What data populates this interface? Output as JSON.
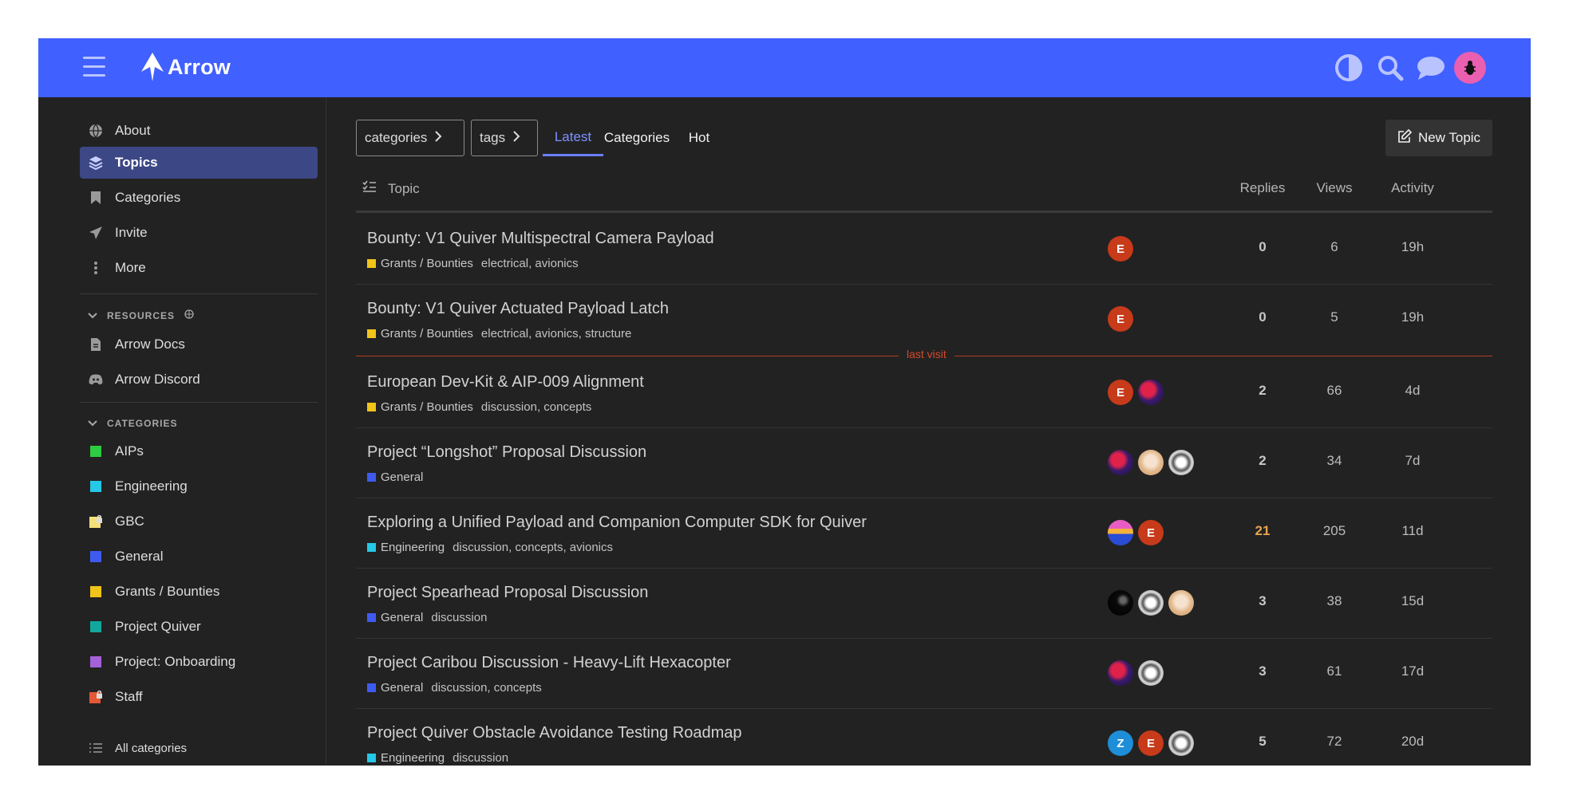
{
  "header": {
    "app_name": "Arrow",
    "accent": "#4060ff",
    "icons": [
      "menu-icon",
      "theme-toggle-icon",
      "search-icon",
      "chat-icon",
      "user-avatar"
    ]
  },
  "sidebar": {
    "main_items": [
      {
        "label": "About",
        "icon": "globe-icon"
      },
      {
        "label": "Topics",
        "icon": "layers-icon",
        "active": true
      },
      {
        "label": "Categories",
        "icon": "bookmark-icon"
      },
      {
        "label": "Invite",
        "icon": "paper-plane-icon"
      },
      {
        "label": "More",
        "icon": "more-vertical-icon"
      }
    ],
    "resources_heading": "RESOURCES",
    "resources": [
      {
        "label": "Arrow Docs",
        "icon": "document-icon"
      },
      {
        "label": "Arrow Discord",
        "icon": "discord-icon"
      }
    ],
    "categories_heading": "CATEGORIES",
    "categories": [
      {
        "label": "AIPs",
        "color": "#2ecc40"
      },
      {
        "label": "Engineering",
        "color": "#25c8e6"
      },
      {
        "label": "GBC",
        "color": "#f4e07a",
        "locked": true
      },
      {
        "label": "General",
        "color": "#3f5bef"
      },
      {
        "label": "Grants / Bounties",
        "color": "#f0c419"
      },
      {
        "label": "Project Quiver",
        "color": "#12a89d"
      },
      {
        "label": "Project: Onboarding",
        "color": "#a461d8"
      },
      {
        "label": "Staff",
        "color": "#e45735",
        "locked": true
      }
    ],
    "all_categories": "All categories"
  },
  "filters": {
    "categories": "categories",
    "tags": "tags",
    "tabs": [
      {
        "label": "Latest",
        "active": true
      },
      {
        "label": "Categories"
      },
      {
        "label": "Hot"
      }
    ],
    "new_topic": "New Topic"
  },
  "table": {
    "col_topic": "Topic",
    "col_replies": "Replies",
    "col_views": "Views",
    "col_activity": "Activity",
    "last_visit": "last visit",
    "rows": [
      {
        "title": "Bounty: V1 Quiver Multispectral Camera Payload",
        "category": "Grants / Bounties",
        "cat_color": "#f0c419",
        "tags": "electrical, avionics",
        "posters": [
          "E"
        ],
        "replies": "0",
        "views": "6",
        "activity": "19h"
      },
      {
        "title": "Bounty: V1 Quiver Actuated Payload Latch",
        "category": "Grants / Bounties",
        "cat_color": "#f0c419",
        "tags": "electrical, avionics, structure",
        "posters": [
          "E"
        ],
        "replies": "0",
        "views": "5",
        "activity": "19h"
      },
      {
        "title": "European Dev-Kit & AIP-009 Alignment",
        "category": "Grants / Bounties",
        "cat_color": "#f0c419",
        "tags": "discussion, concepts",
        "posters": [
          "E",
          "img-spider"
        ],
        "replies": "2",
        "views": "66",
        "activity": "4d"
      },
      {
        "title": "Project “Longshot” Proposal Discussion",
        "category": "General",
        "cat_color": "#3f5bef",
        "tags": "",
        "posters": [
          "img-spider",
          "img-blonde",
          "img-bw"
        ],
        "replies": "2",
        "views": "34",
        "activity": "7d"
      },
      {
        "title": "Exploring a Unified Payload and Companion Computer SDK for Quiver",
        "category": "Engineering",
        "cat_color": "#25c8e6",
        "tags": "discussion, concepts, avionics",
        "posters": [
          "img-sunset",
          "E"
        ],
        "replies": "21",
        "hot": true,
        "views": "205",
        "activity": "11d"
      },
      {
        "title": "Project Spearhead Proposal Discussion",
        "category": "General",
        "cat_color": "#3f5bef",
        "tags": "discussion",
        "posters": [
          "img-dark",
          "img-bw",
          "img-blonde"
        ],
        "replies": "3",
        "views": "38",
        "activity": "15d"
      },
      {
        "title": "Project Caribou Discussion - Heavy-Lift Hexacopter",
        "category": "General",
        "cat_color": "#3f5bef",
        "tags": "discussion, concepts",
        "posters": [
          "img-spider",
          "img-bw"
        ],
        "replies": "3",
        "views": "61",
        "activity": "17d"
      },
      {
        "title": "Project Quiver Obstacle Avoidance Testing Roadmap",
        "category": "Engineering",
        "cat_color": "#25c8e6",
        "tags": "discussion",
        "posters": [
          "Z",
          "E",
          "img-bw"
        ],
        "replies": "5",
        "views": "72",
        "activity": "20d"
      }
    ]
  }
}
